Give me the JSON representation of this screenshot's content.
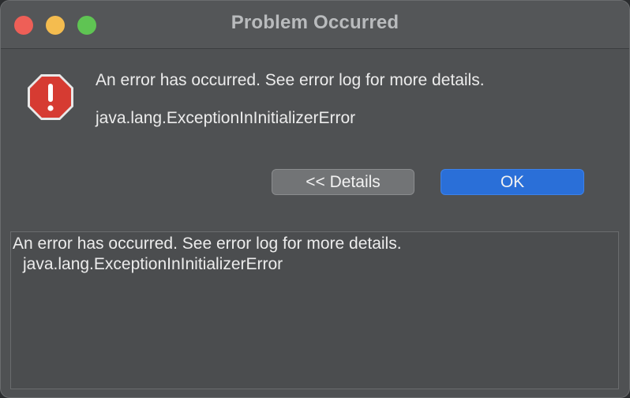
{
  "window": {
    "title": "Problem Occurred"
  },
  "dialog": {
    "icon": "error-stop-icon",
    "message": "An error has occurred. See error log for more details.",
    "exception": "java.lang.ExceptionInInitializerError"
  },
  "buttons": {
    "details_label": "<< Details",
    "ok_label": "OK"
  },
  "details": {
    "line1": "An error has occurred. See error log for more details.",
    "line2": "java.lang.ExceptionInInitializerError"
  },
  "colors": {
    "accent": "#2a6fd8",
    "error_icon": "#d63b32"
  }
}
